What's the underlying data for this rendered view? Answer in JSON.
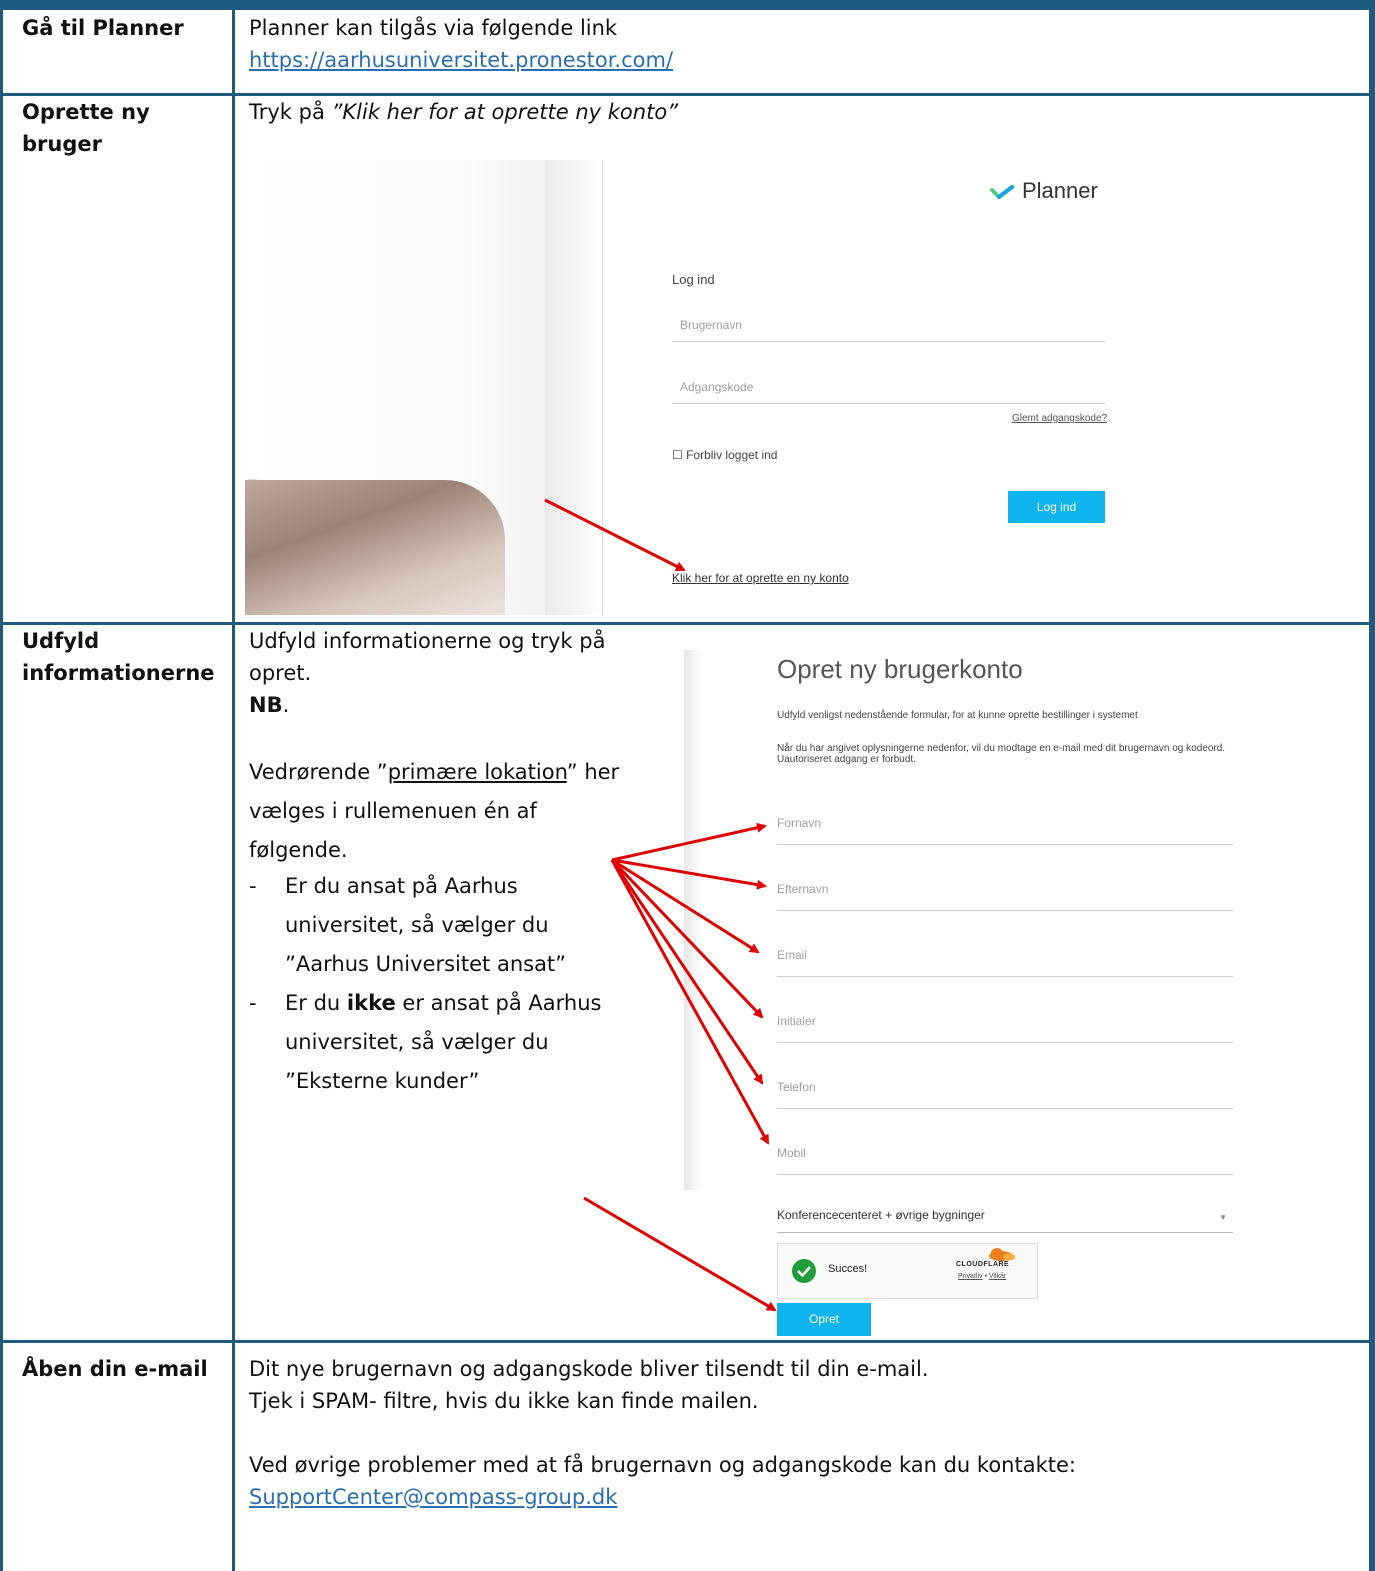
{
  "rows": [
    {
      "heading": "Gå til Planner",
      "line1": "Planner kan tilgås via følgende link",
      "link": "https://aarhusuniversitet.pronestor.com/"
    },
    {
      "heading_line1": "Oprette ny",
      "heading_line2": "bruger",
      "intro": "Tryk på",
      "intro_quote": "”Klik her for at oprette ny konto”"
    },
    {
      "heading_line1": "Udfyld",
      "heading_line2": "informationerne",
      "p1_line1": "Udfyld informationerne og tryk på",
      "p1_line2": "opret.",
      "nb": "NB",
      "nb_dot": ".",
      "p2_line1_a": "Vedrørende ”",
      "p2_line1_link": "primære lokation",
      "p2_line1_b": "” her",
      "p2_line2": "vælges i rullemenuen én af",
      "p2_line3": "følgende.",
      "b1_line1": "Er du ansat på Aarhus",
      "b1_line2": "universitet, så vælger du",
      "b1_line3": "”Aarhus Universitet ansat”",
      "b2_line1_a": "Er du ",
      "b2_line1_bold": "ikke",
      "b2_line1_b": " er ansat på Aarhus",
      "b2_line2": "universitet, så vælger du",
      "b2_line3": "”Eksterne kunder”",
      "dash": "-"
    },
    {
      "heading": "Åben din e-mail",
      "line1": "Dit nye brugernavn og adgangskode bliver tilsendt til din e-mail.",
      "line2": "Tjek i SPAM- filtre, hvis du ikke kan finde mailen.",
      "line3": "Ved øvrige problemer med at få brugernavn og adgangskode kan du kontakte:",
      "email": "SupportCenter@compass-group.dk"
    }
  ],
  "login_screen": {
    "brand": "Planner",
    "heading": "Log ind",
    "username_placeholder": "Brugernavn",
    "password_placeholder": "Adgangskode",
    "forgot": "Glemt adgangskode?",
    "remember": "☐ Forbliv logget ind",
    "login_button": "Log ind",
    "create_link": "Klik her for at oprette en ny konto"
  },
  "create_screen": {
    "title": "Opret ny brugerkonto",
    "intro1": "Udfyld venligst nedenstående formular, for at kunne oprette bestillinger i systemet",
    "intro2": "Når du har angivet oplysningerne nedenfor, vil du modtage en e-mail med dit brugernavn og kodeord. Uautoriseret adgang er forbudt.",
    "fields": [
      "Fornavn",
      "Efternavn",
      "Email",
      "Initialer",
      "Telefon",
      "Mobil"
    ],
    "location_select": "Konferencecenteret + øvrige bygninger",
    "captcha_status": "Succes!",
    "captcha_brand": "CLOUDFLARE",
    "captcha_privacy": "Privatliv",
    "captcha_sep": " • ",
    "captcha_terms": "Vilkår",
    "submit": "Opret"
  },
  "colors": {
    "table_border": "#1f5a7f",
    "link": "#2a6fb5",
    "button_blue": "#10b4ef",
    "arrow": "#e00000"
  }
}
